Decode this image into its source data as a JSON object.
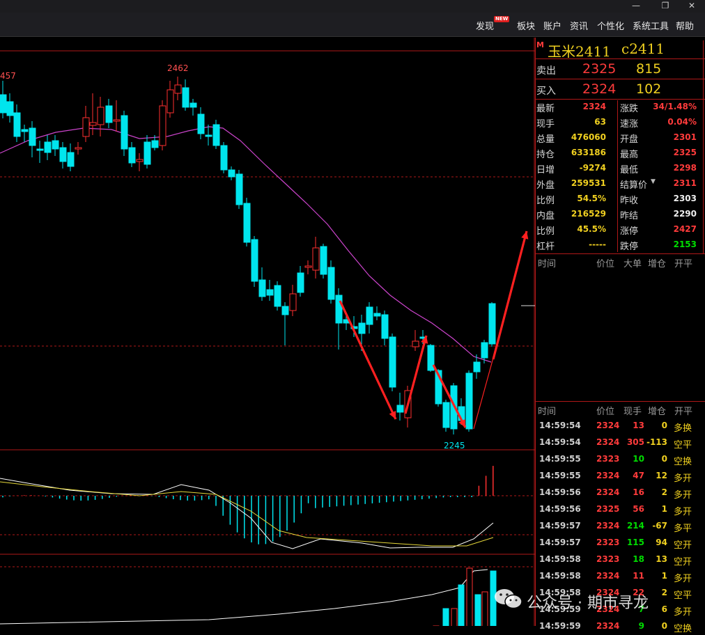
{
  "menu": {
    "items": [
      "发现",
      "板块",
      "账户",
      "资讯",
      "个性化",
      "系统工具",
      "帮助"
    ],
    "new_badge": "NEW"
  },
  "chart": {
    "labels": {
      "left_high": "457",
      "high": "2462",
      "low": "2245"
    },
    "colors": {
      "up": "#ff3030",
      "down": "#00e5ee",
      "ma": "#cc44cc",
      "macd_fast": "#ffffff",
      "macd_slow": "#e6d83a",
      "grid": "#b01818"
    }
  },
  "quote": {
    "marker": "M",
    "name": "玉米2411",
    "code": "c2411",
    "sell": {
      "label": "卖出",
      "price": "2325",
      "volume": "815"
    },
    "buy": {
      "label": "买入",
      "price": "2324",
      "volume": "102"
    },
    "left": [
      {
        "label": "最新",
        "value": "2324",
        "color": "red"
      },
      {
        "label": "现手",
        "value": "63",
        "color": "yel"
      },
      {
        "label": "总量",
        "value": "476060",
        "color": "yel"
      },
      {
        "label": "持仓",
        "value": "633186",
        "color": "yel"
      },
      {
        "label": "日增",
        "value": "-9274",
        "color": "yel"
      },
      {
        "label": "外盘",
        "value": "259531",
        "color": "yel"
      },
      {
        "label": "比例",
        "value": "54.5%",
        "color": "yel"
      },
      {
        "label": "内盘",
        "value": "216529",
        "color": "yel"
      },
      {
        "label": "比例",
        "value": "45.5%",
        "color": "yel"
      },
      {
        "label": "杠杆",
        "value": "-----",
        "color": "yel"
      }
    ],
    "right": [
      {
        "label": "涨跌",
        "value": "34/1.48%",
        "color": "red"
      },
      {
        "label": "速涨",
        "value": "0.04%",
        "color": "red"
      },
      {
        "label": "开盘",
        "value": "2301",
        "color": "red"
      },
      {
        "label": "最高",
        "value": "2325",
        "color": "red"
      },
      {
        "label": "最低",
        "value": "2298",
        "color": "red"
      },
      {
        "label": "结算价",
        "value": "2311",
        "color": "red"
      },
      {
        "label": "昨收",
        "value": "2303",
        "color": "wht"
      },
      {
        "label": "昨结",
        "value": "2290",
        "color": "wht"
      },
      {
        "label": "涨停",
        "value": "2427",
        "color": "red"
      },
      {
        "label": "跌停",
        "value": "2153",
        "color": "grn"
      }
    ]
  },
  "big_orders_header": [
    "时间",
    "价位",
    "大单",
    "增仓",
    "开平"
  ],
  "trades_header": [
    "时间",
    "价位",
    "现手",
    "增仓",
    "开平"
  ],
  "trades": [
    {
      "time": "14:59:54",
      "price": "2324",
      "pc": "red",
      "vol": "13",
      "vc": "red",
      "oi": "0",
      "oc": "yel",
      "type": "多换",
      "tc": "yel"
    },
    {
      "time": "14:59:54",
      "price": "2324",
      "pc": "red",
      "vol": "305",
      "vc": "red",
      "oi": "-113",
      "oc": "yel",
      "type": "空平",
      "tc": "yel"
    },
    {
      "time": "14:59:55",
      "price": "2323",
      "pc": "red",
      "vol": "10",
      "vc": "grn",
      "oi": "0",
      "oc": "yel",
      "type": "空换",
      "tc": "yel"
    },
    {
      "time": "14:59:55",
      "price": "2324",
      "pc": "red",
      "vol": "47",
      "vc": "red",
      "oi": "12",
      "oc": "yel",
      "type": "多开",
      "tc": "yel"
    },
    {
      "time": "14:59:56",
      "price": "2324",
      "pc": "red",
      "vol": "16",
      "vc": "red",
      "oi": "2",
      "oc": "yel",
      "type": "多开",
      "tc": "yel"
    },
    {
      "time": "14:59:56",
      "price": "2325",
      "pc": "red",
      "vol": "56",
      "vc": "red",
      "oi": "1",
      "oc": "yel",
      "type": "多开",
      "tc": "yel"
    },
    {
      "time": "14:59:57",
      "price": "2324",
      "pc": "red",
      "vol": "214",
      "vc": "grn",
      "oi": "-67",
      "oc": "yel",
      "type": "多平",
      "tc": "yel"
    },
    {
      "time": "14:59:57",
      "price": "2323",
      "pc": "red",
      "vol": "115",
      "vc": "grn",
      "oi": "94",
      "oc": "yel",
      "type": "空开",
      "tc": "yel"
    },
    {
      "time": "14:59:58",
      "price": "2323",
      "pc": "red",
      "vol": "18",
      "vc": "grn",
      "oi": "13",
      "oc": "yel",
      "type": "空开",
      "tc": "yel"
    },
    {
      "time": "14:59:58",
      "price": "2324",
      "pc": "red",
      "vol": "11",
      "vc": "red",
      "oi": "1",
      "oc": "yel",
      "type": "多开",
      "tc": "yel"
    },
    {
      "time": "14:59:58",
      "price": "2324",
      "pc": "red",
      "vol": "22",
      "vc": "red",
      "oi": "2",
      "oc": "yel",
      "type": "空平",
      "tc": "yel"
    },
    {
      "time": "14:59:59",
      "price": "2324",
      "pc": "red",
      "vol": "7",
      "vc": "grn",
      "oi": "6",
      "oc": "yel",
      "type": "多开",
      "tc": "yel"
    },
    {
      "time": "14:59:59",
      "price": "2324",
      "pc": "red",
      "vol": "9",
      "vc": "grn",
      "oi": "0",
      "oc": "yel",
      "type": "空换",
      "tc": "yel"
    }
  ],
  "watermark": "公众号 · 期市寻龙"
}
